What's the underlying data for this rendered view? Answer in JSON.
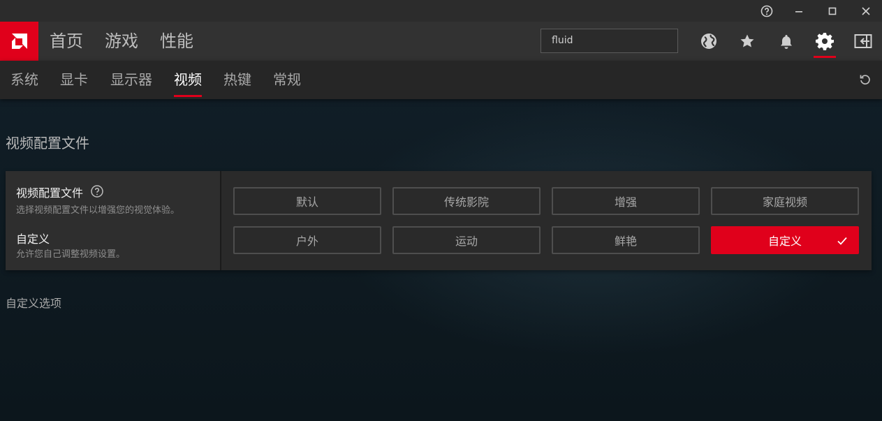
{
  "main_nav": {
    "items": [
      "首页",
      "游戏",
      "性能"
    ],
    "search_value": "fluid"
  },
  "sub_nav": {
    "items": [
      "系统",
      "显卡",
      "显示器",
      "视频",
      "热键",
      "常规"
    ],
    "active": "视频"
  },
  "page": {
    "section_title": "视频配置文件",
    "custom_options_title": "自定义选项"
  },
  "profile_card": {
    "title": "视频配置文件",
    "description": "选择视频配置文件以增强您的视觉体验。",
    "selected_title": "自定义",
    "selected_description": "允许您自己调整视频设置。",
    "options": [
      "默认",
      "传统影院",
      "增强",
      "家庭视频",
      "户外",
      "运动",
      "鲜艳",
      "自定义"
    ],
    "selected_option": "自定义"
  },
  "icons": {
    "titlebar": [
      "help-icon",
      "minimize-icon",
      "maximize-icon",
      "close-icon"
    ],
    "nav": [
      "globe-icon",
      "star-icon",
      "bell-icon",
      "gear-icon",
      "collapse-panel-icon"
    ],
    "subnav": [
      "reset-icon"
    ]
  },
  "colors": {
    "accent": "#e0001b",
    "titlebar_bg": "#2c2c2c",
    "nav_bg": "#323232",
    "subnav_bg": "#262626",
    "card_bg": "#2a2a2a"
  }
}
